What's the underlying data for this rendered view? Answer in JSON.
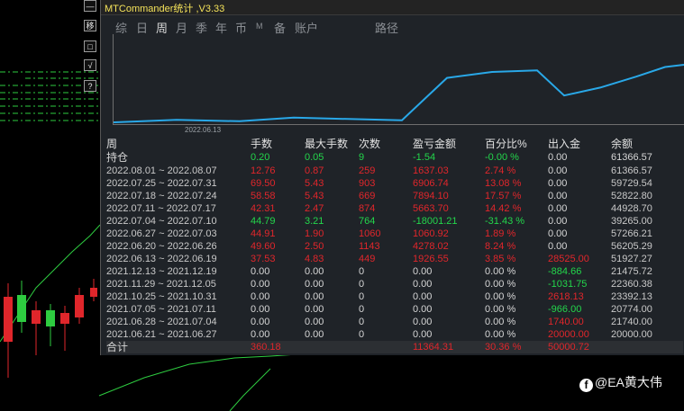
{
  "side_buttons": [
    {
      "label": "—",
      "icon": "minimize-icon"
    },
    {
      "label": "移",
      "icon": "move-icon"
    },
    {
      "label": "□",
      "icon": "window-icon"
    },
    {
      "label": "√",
      "icon": "check-icon"
    },
    {
      "label": "?",
      "icon": "help-icon"
    }
  ],
  "app": {
    "title": "MTCommander统计 ,V3.33"
  },
  "tabs": [
    {
      "label": "综",
      "active": false
    },
    {
      "label": "日",
      "active": false
    },
    {
      "label": "周",
      "active": true
    },
    {
      "label": "月",
      "active": false
    },
    {
      "label": "季",
      "active": false
    },
    {
      "label": "年",
      "active": false
    },
    {
      "label": "币",
      "active": false
    },
    {
      "label": "M",
      "active": false
    },
    {
      "label": "备",
      "active": false
    },
    {
      "label": "账户",
      "active": false
    },
    {
      "label": "路径",
      "active": false
    }
  ],
  "chart_data": {
    "type": "line",
    "x_tick_label": "2022.06.13",
    "x": [
      "2021.06.21",
      "2021.06.28",
      "2021.07.05",
      "2021.10.25",
      "2021.11.29",
      "2021.12.13",
      "2022.06.13",
      "2022.06.20",
      "2022.06.27",
      "2022.07.04",
      "2022.07.11",
      "2022.07.18",
      "2022.07.25",
      "2022.08.01"
    ],
    "series": [
      {
        "values": [
          20000.0,
          21740.0,
          20774.0,
          23392.13,
          22360.38,
          21475.72,
          51927.27,
          56205.29,
          57266.21,
          39265.0,
          44928.7,
          52822.8,
          59729.54,
          61366.57
        ],
        "color": "#29a8e8"
      }
    ],
    "grid": false
  },
  "table": {
    "headers": {
      "period": "周",
      "lots": "手数",
      "max_lots": "最大手数",
      "count": "次数",
      "pnl": "盈亏金额",
      "pct": "百分比%",
      "flow": "出入金",
      "balance": "余额"
    },
    "holding": {
      "period": "持仓",
      "lots": "0.20",
      "max_lots": "0.05",
      "count": "9",
      "pnl": "-1.54",
      "pct": "-0.00 %",
      "flow": "0.00",
      "balance": "61366.57"
    },
    "rows": [
      {
        "period": "2022.08.01 ~ 2022.08.07",
        "lots": "12.76",
        "max_lots": "0.87",
        "count": "259",
        "pnl": "1637.03",
        "pct": "2.74 %",
        "flow": "0.00",
        "balance": "61366.57",
        "tone": "red",
        "flow_tone": "white"
      },
      {
        "period": "2022.07.25 ~ 2022.07.31",
        "lots": "69.50",
        "max_lots": "5.43",
        "count": "903",
        "pnl": "6906.74",
        "pct": "13.08 %",
        "flow": "0.00",
        "balance": "59729.54",
        "tone": "red",
        "flow_tone": "white"
      },
      {
        "period": "2022.07.18 ~ 2022.07.24",
        "lots": "58.58",
        "max_lots": "5.43",
        "count": "669",
        "pnl": "7894.10",
        "pct": "17.57 %",
        "flow": "0.00",
        "balance": "52822.80",
        "tone": "red",
        "flow_tone": "white"
      },
      {
        "period": "2022.07.11 ~ 2022.07.17",
        "lots": "42.31",
        "max_lots": "2.47",
        "count": "874",
        "pnl": "5663.70",
        "pct": "14.42 %",
        "flow": "0.00",
        "balance": "44928.70",
        "tone": "red",
        "flow_tone": "white"
      },
      {
        "period": "2022.07.04 ~ 2022.07.10",
        "lots": "44.79",
        "max_lots": "3.21",
        "count": "764",
        "pnl": "-18001.21",
        "pct": "-31.43 %",
        "flow": "0.00",
        "balance": "39265.00",
        "tone": "green",
        "flow_tone": "white"
      },
      {
        "period": "2022.06.27 ~ 2022.07.03",
        "lots": "44.91",
        "max_lots": "1.90",
        "count": "1060",
        "pnl": "1060.92",
        "pct": "1.89 %",
        "flow": "0.00",
        "balance": "57266.21",
        "tone": "red",
        "flow_tone": "white"
      },
      {
        "period": "2022.06.20 ~ 2022.06.26",
        "lots": "49.60",
        "max_lots": "2.50",
        "count": "1143",
        "pnl": "4278.02",
        "pct": "8.24 %",
        "flow": "0.00",
        "balance": "56205.29",
        "tone": "red",
        "flow_tone": "white"
      },
      {
        "period": "2022.06.13 ~ 2022.06.19",
        "lots": "37.53",
        "max_lots": "4.83",
        "count": "449",
        "pnl": "1926.55",
        "pct": "3.85 %",
        "flow": "28525.00",
        "balance": "51927.27",
        "tone": "red",
        "flow_tone": "red"
      },
      {
        "period": "2021.12.13 ~ 2021.12.19",
        "lots": "0.00",
        "max_lots": "0.00",
        "count": "0",
        "pnl": "0.00",
        "pct": "0.00 %",
        "flow": "-884.66",
        "balance": "21475.72",
        "tone": "white",
        "flow_tone": "green"
      },
      {
        "period": "2021.11.29 ~ 2021.12.05",
        "lots": "0.00",
        "max_lots": "0.00",
        "count": "0",
        "pnl": "0.00",
        "pct": "0.00 %",
        "flow": "-1031.75",
        "balance": "22360.38",
        "tone": "white",
        "flow_tone": "green"
      },
      {
        "period": "2021.10.25 ~ 2021.10.31",
        "lots": "0.00",
        "max_lots": "0.00",
        "count": "0",
        "pnl": "0.00",
        "pct": "0.00 %",
        "flow": "2618.13",
        "balance": "23392.13",
        "tone": "white",
        "flow_tone": "red"
      },
      {
        "period": "2021.07.05 ~ 2021.07.11",
        "lots": "0.00",
        "max_lots": "0.00",
        "count": "0",
        "pnl": "0.00",
        "pct": "0.00 %",
        "flow": "-966.00",
        "balance": "20774.00",
        "tone": "white",
        "flow_tone": "green"
      },
      {
        "period": "2021.06.28 ~ 2021.07.04",
        "lots": "0.00",
        "max_lots": "0.00",
        "count": "0",
        "pnl": "0.00",
        "pct": "0.00 %",
        "flow": "1740.00",
        "balance": "21740.00",
        "tone": "white",
        "flow_tone": "red"
      },
      {
        "period": "2021.06.21 ~ 2021.06.27",
        "lots": "0.00",
        "max_lots": "0.00",
        "count": "0",
        "pnl": "0.00",
        "pct": "0.00 %",
        "flow": "20000.00",
        "balance": "20000.00",
        "tone": "white",
        "flow_tone": "red"
      }
    ],
    "total": {
      "period": "合计",
      "lots": "360.18",
      "pnl": "11364.31",
      "pct": "30.36 %",
      "flow": "50000.72"
    }
  },
  "watermark": {
    "icon": "facebook-icon",
    "icon_glyph": "f",
    "text": "@EA黄大伟"
  },
  "colors": {
    "accent": "#f5e35a",
    "positive": "#e0262b",
    "negative": "#23d64b",
    "line": "#29a8e8",
    "panel_bg": "#1f2328"
  }
}
